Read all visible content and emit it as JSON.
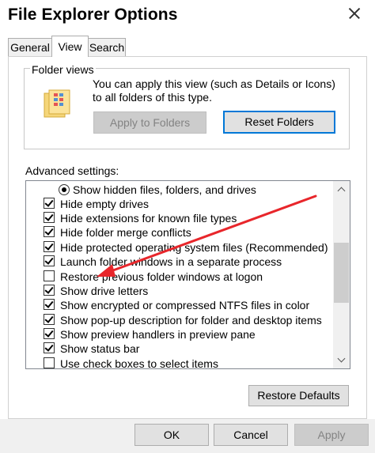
{
  "window": {
    "title": "File Explorer Options",
    "close_icon": "close-icon"
  },
  "tabs": [
    {
      "label": "General",
      "selected": false
    },
    {
      "label": "View",
      "selected": true
    },
    {
      "label": "Search",
      "selected": false
    }
  ],
  "folder_views": {
    "label": "Folder views",
    "icon": "folder-views-icon",
    "description": "You can apply this view (such as Details or Icons) to all folders of this type.",
    "apply_button": "Apply to Folders",
    "reset_button": "Reset Folders"
  },
  "advanced": {
    "label": "Advanced settings:",
    "items": [
      {
        "type": "radio",
        "label": "Show hidden files, folders, and drives",
        "checked": true
      },
      {
        "type": "checkbox",
        "label": "Hide empty drives",
        "checked": true
      },
      {
        "type": "checkbox",
        "label": "Hide extensions for known file types",
        "checked": true
      },
      {
        "type": "checkbox",
        "label": "Hide folder merge conflicts",
        "checked": true
      },
      {
        "type": "checkbox",
        "label": "Hide protected operating system files (Recommended)",
        "checked": true
      },
      {
        "type": "checkbox",
        "label": "Launch folder windows in a separate process",
        "checked": true
      },
      {
        "type": "checkbox",
        "label": "Restore previous folder windows at logon",
        "checked": false
      },
      {
        "type": "checkbox",
        "label": "Show drive letters",
        "checked": true
      },
      {
        "type": "checkbox",
        "label": "Show encrypted or compressed NTFS files in color",
        "checked": true
      },
      {
        "type": "checkbox",
        "label": "Show pop-up description for folder and desktop items",
        "checked": true
      },
      {
        "type": "checkbox",
        "label": "Show preview handlers in preview pane",
        "checked": true
      },
      {
        "type": "checkbox",
        "label": "Show status bar",
        "checked": true
      },
      {
        "type": "checkbox",
        "label": "Use check boxes to select items",
        "checked": false
      }
    ],
    "restore_defaults": "Restore Defaults"
  },
  "footer": {
    "ok": "OK",
    "cancel": "Cancel",
    "apply": "Apply"
  },
  "colors": {
    "focus_border": "#0078d7",
    "annotation_arrow": "#e8262b"
  }
}
